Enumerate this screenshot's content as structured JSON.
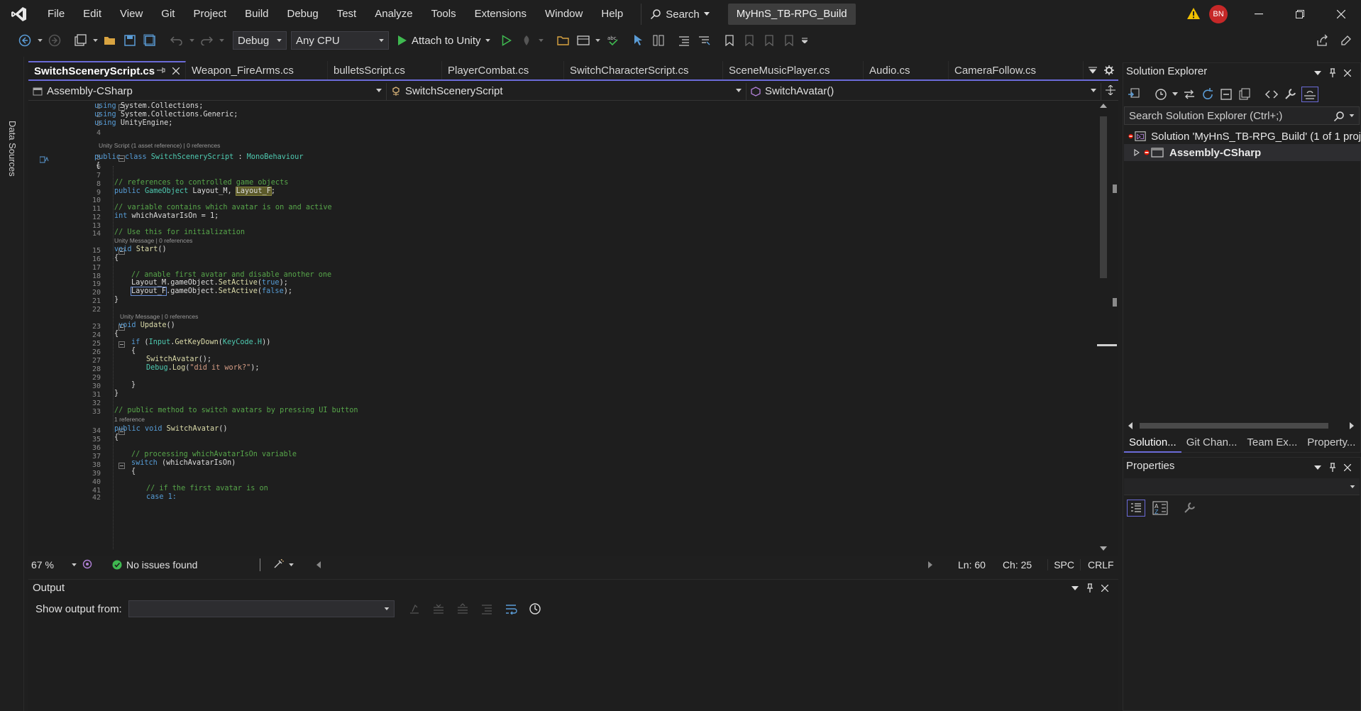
{
  "menu": {
    "items": [
      "File",
      "Edit",
      "View",
      "Git",
      "Project",
      "Build",
      "Debug",
      "Test",
      "Analyze",
      "Tools",
      "Extensions",
      "Window",
      "Help"
    ],
    "search_label": "Search",
    "solution_title": "MyHnS_TB-RPG_Build",
    "avatar_initials": "BN"
  },
  "toolbar": {
    "configuration": "Debug",
    "platform": "Any CPU",
    "attach_label": "Attach to Unity"
  },
  "side_strip": {
    "label": "Data Sources"
  },
  "tabs": [
    {
      "label": "SwitchSceneryScript.cs",
      "active": true
    },
    {
      "label": "Weapon_FireArms.cs"
    },
    {
      "label": "bulletsScript.cs"
    },
    {
      "label": "PlayerCombat.cs"
    },
    {
      "label": "SwitchCharacterScript.cs"
    },
    {
      "label": "SceneMusicPlayer.cs"
    },
    {
      "label": "Audio.cs"
    },
    {
      "label": "CameraFollow.cs"
    }
  ],
  "navbar": {
    "project": "Assembly-CSharp",
    "class": "SwitchSceneryScript",
    "member": "SwitchAvatar()"
  },
  "code": {
    "lines": [
      "1",
      "2",
      "3",
      "4",
      "5",
      "6",
      "7",
      "8",
      "9",
      "10",
      "11",
      "12",
      "13",
      "14",
      "15",
      "16",
      "17",
      "18",
      "19",
      "20",
      "21",
      "22",
      "23",
      "24",
      "25",
      "26",
      "27",
      "28",
      "29",
      "30",
      "31",
      "32",
      "33",
      "34",
      "35",
      "36",
      "37",
      "38",
      "39",
      "40",
      "41",
      "42"
    ],
    "lens_unity_script": "Unity Script (1 asset reference) | 0 references",
    "lens_unity_message": "Unity Message | 0 references",
    "lens_one_ref": "1 reference",
    "t": {
      "using": "using",
      "system_collections": "System.Collections;",
      "system_collections_generic": "System.Collections.Generic;",
      "unity_engine": "UnityEngine;",
      "public": "public",
      "class": "class",
      "class_name": "SwitchSceneryScript",
      "colon": " : ",
      "mono": "MonoBehaviour",
      "brace_open": "{",
      "brace_close": "}",
      "comment_refs": "// references to controlled game objects",
      "gameobject": "GameObject",
      "layout_m_decl": " Layout_M, ",
      "layout_f": "Layout_F",
      "semi": ";",
      "comment_variable": "// variable contains which avatar is on and active",
      "int": "int",
      "which_decl": " whichAvatarIsOn = 1;",
      "comment_init": "// Use this for initialization",
      "void": "void",
      "start": "Start",
      "parens": "()",
      "comment_enable": "// anable first avatar and disable another one",
      "layout_m": "Layout_M",
      "dot_go": ".gameObject.",
      "set_active": "SetActive",
      "true": "true",
      "false": "false",
      "paren_open": "(",
      "paren_close_semi": ");",
      "update": "Update",
      "if": "if",
      "input": "Input",
      "get_key_down": "GetKeyDown",
      "keycode_h": "KeyCode.H",
      "double_close": "))",
      "switch_avatar_call": "SwitchAvatar",
      "call_end": "();",
      "debug": "Debug",
      "log": "Log",
      "did_it_work": "\"did it work?\"",
      "comment_public_method": "// public method to switch avatars by pressing UI button",
      "switch_avatar": "SwitchAvatar",
      "comment_processing": "// processing whichAvatarIsOn variable",
      "switch": "switch",
      "switch_arg": " (whichAvatarIsOn)",
      "comment_first": "// if the first avatar is on",
      "case_1": "case 1:"
    }
  },
  "editor_status": {
    "zoom": "67 %",
    "issues": "No issues found",
    "line": "Ln: 60",
    "column": "Ch: 25",
    "indent": "SPC",
    "line_ending": "CRLF"
  },
  "output": {
    "title": "Output",
    "show_from_label": "Show output from:",
    "show_from_value": ""
  },
  "solution_explorer": {
    "title": "Solution Explorer",
    "search_placeholder": "Search Solution Explorer (Ctrl+;)",
    "solution_node": "Solution 'MyHnS_TB-RPG_Build' (1 of 1 proj",
    "project_node": "Assembly-CSharp",
    "tabs": [
      "Solution...",
      "Git Chan...",
      "Team Ex...",
      "Property..."
    ]
  },
  "properties": {
    "title": "Properties"
  },
  "colors": {
    "accent": "#6b6bd8",
    "keyword": "#569cd6",
    "type": "#4ec9b0",
    "comment": "#57a64a",
    "string": "#d69d85",
    "method": "#dcdcaa",
    "error_red": "#e51400",
    "warning_yellow": "#f0c000",
    "run_green": "#3fb950"
  }
}
